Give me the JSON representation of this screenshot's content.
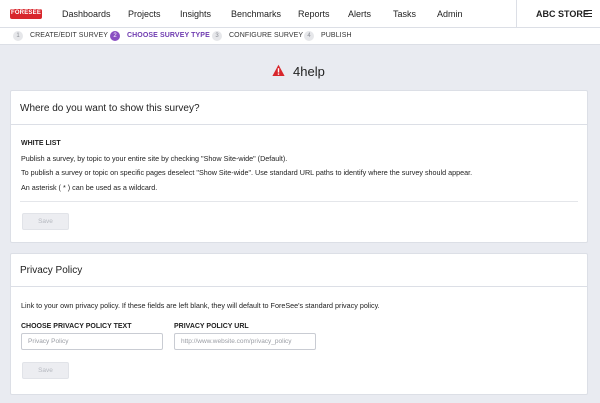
{
  "topnav": {
    "logo_text": "FORESEE",
    "items": [
      {
        "label": "Dashboards"
      },
      {
        "label": "Projects"
      },
      {
        "label": "Insights"
      },
      {
        "label": "Benchmarks"
      },
      {
        "label": "Reports"
      },
      {
        "label": "Alerts"
      },
      {
        "label": "Tasks"
      },
      {
        "label": "Admin"
      }
    ],
    "store": "ABC STORE",
    "menu_icon": "hamburger-icon"
  },
  "steps": [
    {
      "num": "1",
      "label": "CREATE/EDIT SURVEY",
      "active": false
    },
    {
      "num": "2",
      "label": "CHOOSE SURVEY TYPE",
      "active": true
    },
    {
      "num": "3",
      "label": "CONFIGURE SURVEY",
      "active": false
    },
    {
      "num": "4",
      "label": "PUBLISH",
      "active": false
    }
  ],
  "heading": {
    "icon": "warning-icon",
    "text": "4help",
    "icon_color": "#d8262c"
  },
  "survey_card": {
    "title": "Where do you want to show this survey?",
    "section_label": "WHITE LIST",
    "lines": [
      "Publish a survey, by topic to your entire site by checking \"Show Site-wide\" (Default).",
      "To publish a survey or topic on specific pages deselect \"Show Site-wide\". Use standard URL paths to identify where the survey should appear.",
      "An asterisk ( * ) can be used as a wildcard."
    ],
    "save_label": "Save"
  },
  "privacy_card": {
    "title": "Privacy Policy",
    "description": "Link to your own privacy policy. If these fields are left blank, they will default to ForeSee's standard privacy policy.",
    "text_label": "CHOOSE PRIVACY POLICY TEXT",
    "text_placeholder": "Privacy Policy",
    "url_label": "PRIVACY POLICY URL",
    "url_placeholder": "http://www.website.com/privacy_policy",
    "save_label": "Save"
  },
  "colors": {
    "accent": "#8a4fc2",
    "brand": "#d8262c"
  }
}
